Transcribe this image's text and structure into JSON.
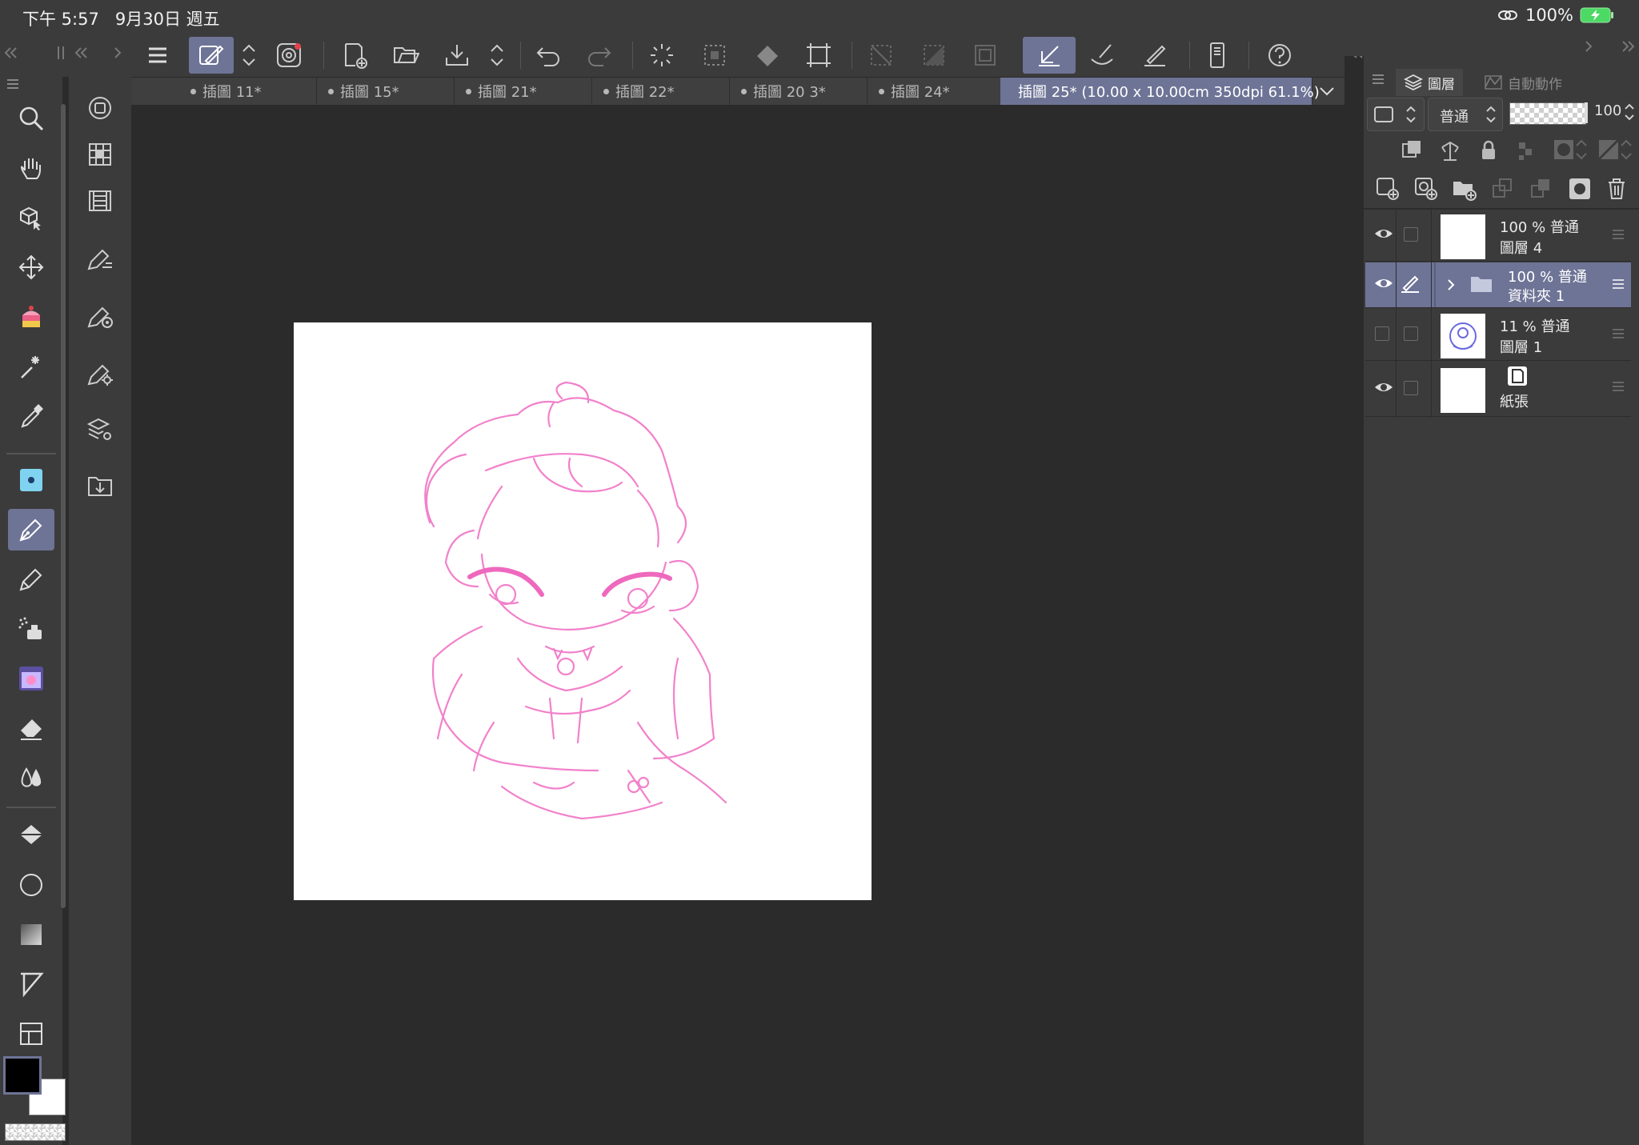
{
  "status_bar": {
    "time": "下午 5:57",
    "date": "9月30日 週五",
    "battery": "100%"
  },
  "toolbar": {
    "icons": [
      "menu-icon",
      "tool-property-icon",
      "updown-icon",
      "spiral-icon",
      "new-canvas-icon",
      "open-icon",
      "save-icon",
      "updown-icon",
      "undo-icon",
      "redo-icon",
      "loading-icon",
      "selection-icon",
      "fill-icon",
      "transform-icon",
      "deselect-icon",
      "invert-icon",
      "border-icon",
      "snap-icon",
      "ruler-icon",
      "brush-icon",
      "smartphone-icon",
      "help-icon"
    ]
  },
  "tabs": [
    {
      "label": "插圖 11*"
    },
    {
      "label": "插圖 15*"
    },
    {
      "label": "插圖 21*"
    },
    {
      "label": "插圖 22*"
    },
    {
      "label": "插圖 20 3*"
    },
    {
      "label": "插圖 24*"
    },
    {
      "label": "插圖 25* (10.00 x 10.00cm 350dpi 61.1%)",
      "active": true
    }
  ],
  "tools": [
    "zoom-icon",
    "hand-icon",
    "3d-object-icon",
    "move-icon",
    "cake-icon",
    "auto-select-icon",
    "eyedropper-icon",
    "color-chip-icon",
    "pen-icon",
    "pencil-icon",
    "airbrush-icon",
    "decoration-icon",
    "eraser-icon",
    "blend-icon",
    "fill-bucket-icon",
    "ellipse-icon",
    "gradient-icon",
    "frame-icon",
    "panel-icon"
  ],
  "colors": {
    "accent": "#6e7496",
    "main_color": "#000000",
    "sub_color": "#ffffff",
    "sketch": "#f06cc2"
  },
  "layer_panel": {
    "tab_layers": "圖層",
    "tab_auto_action": "自動動作",
    "blend_mode": "普通",
    "opacity": "100",
    "layers": [
      {
        "percent": "100 %",
        "mode": "普通",
        "name": "圖層 4",
        "visible": true,
        "type": "raster"
      },
      {
        "percent": "100 %",
        "mode": "普通",
        "name": "資料夾 1",
        "visible": true,
        "type": "folder",
        "selected": true
      },
      {
        "percent": "11 %",
        "mode": "普通",
        "name": "圖層 1",
        "visible": false,
        "type": "raster"
      },
      {
        "percent": "",
        "mode": "",
        "name": "紙張",
        "visible": true,
        "type": "paper"
      }
    ]
  }
}
